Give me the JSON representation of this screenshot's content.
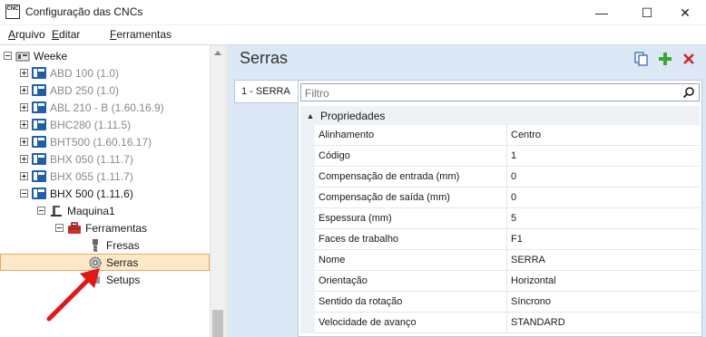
{
  "window": {
    "title": "Configuração das CNCs",
    "app_icon": "CNC",
    "minimize_glyph": "—",
    "maximize_glyph": "☐",
    "close_glyph": "✕"
  },
  "menu": {
    "items": [
      {
        "first": "A",
        "rest": "rquivo"
      },
      {
        "first": "E",
        "rest": "ditar"
      },
      {
        "first": "F",
        "rest": "erramentas"
      }
    ]
  },
  "tree": {
    "root": "Weeke",
    "machines": [
      {
        "label": "ABD 100 (1.0)"
      },
      {
        "label": "ABD 250 (1.0)"
      },
      {
        "label": "ABL 210 - B (1.60.16.9)"
      },
      {
        "label": "BHC280 (1.11.5)"
      },
      {
        "label": "BHT500 (1.60.16.17)"
      },
      {
        "label": "BHX 050 (1.11.7)"
      },
      {
        "label": "BHX 055 (1.11.7)"
      },
      {
        "label": "BHX 500 (1.11.6)"
      }
    ],
    "maquina": "Maquina1",
    "ferramentas": "Ferramentas",
    "fresas": "Fresas",
    "serras": "Serras",
    "setups": "Setups"
  },
  "panel": {
    "title": "Serras",
    "tab_label": "1 - SERRA",
    "filter_placeholder": "Filtro",
    "category": "Propriedades",
    "properties": [
      {
        "name": "Alinhamento",
        "value": "Centro"
      },
      {
        "name": "Código",
        "value": "1"
      },
      {
        "name": "Compensação de entrada (mm)",
        "value": "0"
      },
      {
        "name": "Compensação de saída (mm)",
        "value": "0"
      },
      {
        "name": "Espessura (mm)",
        "value": "5"
      },
      {
        "name": "Faces de trabalho",
        "value": "F1"
      },
      {
        "name": "Nome",
        "value": "SERRA"
      },
      {
        "name": "Orientação",
        "value": "Horizontal"
      },
      {
        "name": "Sentido da rotação",
        "value": "Síncrono"
      },
      {
        "name": "Velocidade de avanço",
        "value": "STANDARD"
      }
    ]
  },
  "colors": {
    "selection_bg": "#fde9c9",
    "selection_border": "#e8a85a",
    "panel_bg": "#dce8f6",
    "add_icon": "#3aa830",
    "delete_icon": "#d82020",
    "arrow": "#e01818"
  },
  "icons": {
    "tree": [
      "folder-icon",
      "machine-icon",
      "tools-icon",
      "milling-icon",
      "saw-icon"
    ],
    "toolbar": [
      "copy-icon",
      "add-icon",
      "delete-icon"
    ],
    "search": "search-icon"
  }
}
